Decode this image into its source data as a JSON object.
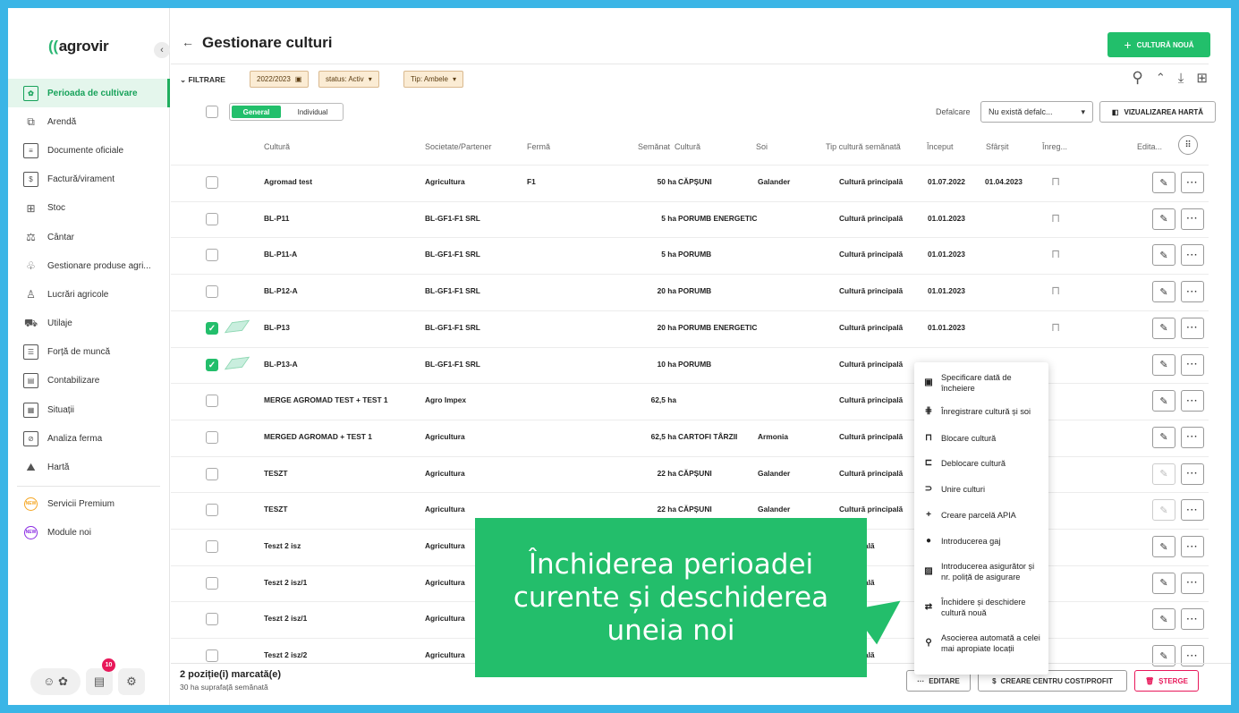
{
  "app": {
    "brand": "agrovir"
  },
  "sidebar": {
    "items": [
      {
        "label": "Perioada de cultivare",
        "icon": "calendar-plant-icon",
        "active": true
      },
      {
        "label": "Arendă",
        "icon": "puzzle-icon"
      },
      {
        "label": "Documente oficiale",
        "icon": "document-icon"
      },
      {
        "label": "Factură/virament",
        "icon": "invoice-icon"
      },
      {
        "label": "Stoc",
        "icon": "stock-icon"
      },
      {
        "label": "Cântar",
        "icon": "scale-icon"
      },
      {
        "label": "Gestionare produse agri...",
        "icon": "plant-hand-icon"
      },
      {
        "label": "Lucrări agricole",
        "icon": "field-work-icon"
      },
      {
        "label": "Utilaje",
        "icon": "tractor-icon"
      },
      {
        "label": "Forță de muncă",
        "icon": "worker-card-icon"
      },
      {
        "label": "Contabilizare",
        "icon": "accounting-icon"
      },
      {
        "label": "Situații",
        "icon": "table-report-icon"
      },
      {
        "label": "Analiza ferma",
        "icon": "analysis-icon"
      },
      {
        "label": "Hartă",
        "icon": "map-icon"
      }
    ],
    "extra": [
      {
        "label": "Servicii Premium",
        "badge": "NEW"
      },
      {
        "label": "Module noi",
        "badge": "NEW"
      }
    ],
    "notif_count": "10"
  },
  "header": {
    "title": "Gestionare culturi",
    "new_button": "CULTURĂ NOUĂ"
  },
  "filters": {
    "label": "FILTRARE",
    "chips": [
      "2022/2023",
      "status: Activ",
      "Tip: Ambele"
    ]
  },
  "view": {
    "tabs": [
      "General",
      "Individual"
    ],
    "breakdown_label": "Defalcare",
    "breakdown_value": "Nu există defalc...",
    "map_button": "VIZUALIZAREA HARTĂ"
  },
  "table": {
    "headers": [
      "Cultură",
      "Societate/Partener",
      "Fermă",
      "Semănat",
      "Cultură",
      "Soi",
      "Tip cultură semănată",
      "Început",
      "Sfârșit",
      "Înreg...",
      "Edita..."
    ],
    "rows": [
      [
        "Agromad test",
        "Agricultura",
        "F1",
        "50 ha",
        "CĂPȘUNI",
        "Galander",
        "Cultură principală",
        "01.07.2022",
        "01.04.2023"
      ],
      [
        "BL-P11",
        "BL-GF1-F1 SRL",
        "",
        "5 ha",
        "PORUMB ENERGETIC",
        "",
        "Cultură principală",
        "01.01.2023",
        ""
      ],
      [
        "BL-P11-A",
        "BL-GF1-F1 SRL",
        "",
        "5 ha",
        "PORUMB",
        "",
        "Cultură principală",
        "01.01.2023",
        ""
      ],
      [
        "BL-P12-A",
        "BL-GF1-F1 SRL",
        "",
        "20 ha",
        "PORUMB",
        "",
        "Cultură principală",
        "01.01.2023",
        ""
      ],
      [
        "BL-P13",
        "BL-GF1-F1 SRL",
        "",
        "20 ha",
        "PORUMB ENERGETIC",
        "",
        "Cultură principală",
        "01.01.2023",
        ""
      ],
      [
        "BL-P13-A",
        "BL-GF1-F1 SRL",
        "",
        "10 ha",
        "PORUMB",
        "",
        "Cultură principală",
        "",
        ""
      ],
      [
        "MERGE AGROMAD TEST + TEST 1",
        "Agro Impex",
        "",
        "62,5 ha",
        "",
        "",
        "Cultură principală",
        "",
        ""
      ],
      [
        "MERGED AGROMAD + TEST 1",
        "Agricultura",
        "",
        "62,5 ha",
        "CARTOFI TÂRZII",
        "Armonia",
        "Cultură principală",
        "",
        ""
      ],
      [
        "TESZT",
        "Agricultura",
        "",
        "22 ha",
        "CĂPȘUNI",
        "Galander",
        "Cultură principală",
        "",
        ""
      ],
      [
        "TESZT",
        "Agricultura",
        "",
        "22 ha",
        "CĂPȘUNI",
        "Galander",
        "Cultură principală",
        "",
        ""
      ],
      [
        "Teszt 2 isz",
        "Agricultura",
        "",
        "",
        "",
        "",
        "principală",
        "",
        ""
      ],
      [
        "Teszt 2 isz/1",
        "Agricultura",
        "",
        "",
        "",
        "",
        "principală",
        "",
        ""
      ],
      [
        "Teszt 2 isz/1",
        "Agricultura",
        "",
        "",
        "",
        "",
        "",
        "",
        " "
      ],
      [
        "Teszt 2 isz/2",
        "Agricultura",
        "",
        "",
        "",
        "",
        "principală",
        "",
        ""
      ]
    ]
  },
  "context_menu": [
    {
      "icon": "calendar-icon",
      "label": "Specificare dată de încheiere"
    },
    {
      "icon": "wheat-icon",
      "label": "Înregistrare cultură și soi"
    },
    {
      "icon": "lock-icon",
      "label": "Blocare cultură"
    },
    {
      "icon": "unlock-icon",
      "label": "Deblocare cultură"
    },
    {
      "icon": "merge-icon",
      "label": "Unire culturi"
    },
    {
      "icon": "plus-icon",
      "label": "Creare parcelă APIA"
    },
    {
      "icon": "person-icon",
      "label": "Introducerea gaj"
    },
    {
      "icon": "insurance-icon",
      "label": "Introducerea asigurător și nr. poliță de asigurare"
    },
    {
      "icon": "cycle-icon",
      "label": "Închidere și deschidere cultură nouă"
    },
    {
      "icon": "route-icon",
      "label": "Asocierea automată a celei mai apropiate locații"
    }
  ],
  "footer": {
    "selected": "2 poziție(i) marcată(e)",
    "area": "30 ha suprafață semănată",
    "edit": "EDITARE",
    "cost": "CREARE CENTRU COST/PROFIT",
    "delete": "ȘTERGE"
  },
  "callout": {
    "text": "Închiderea perioadei curente și deschiderea uneia noi"
  }
}
